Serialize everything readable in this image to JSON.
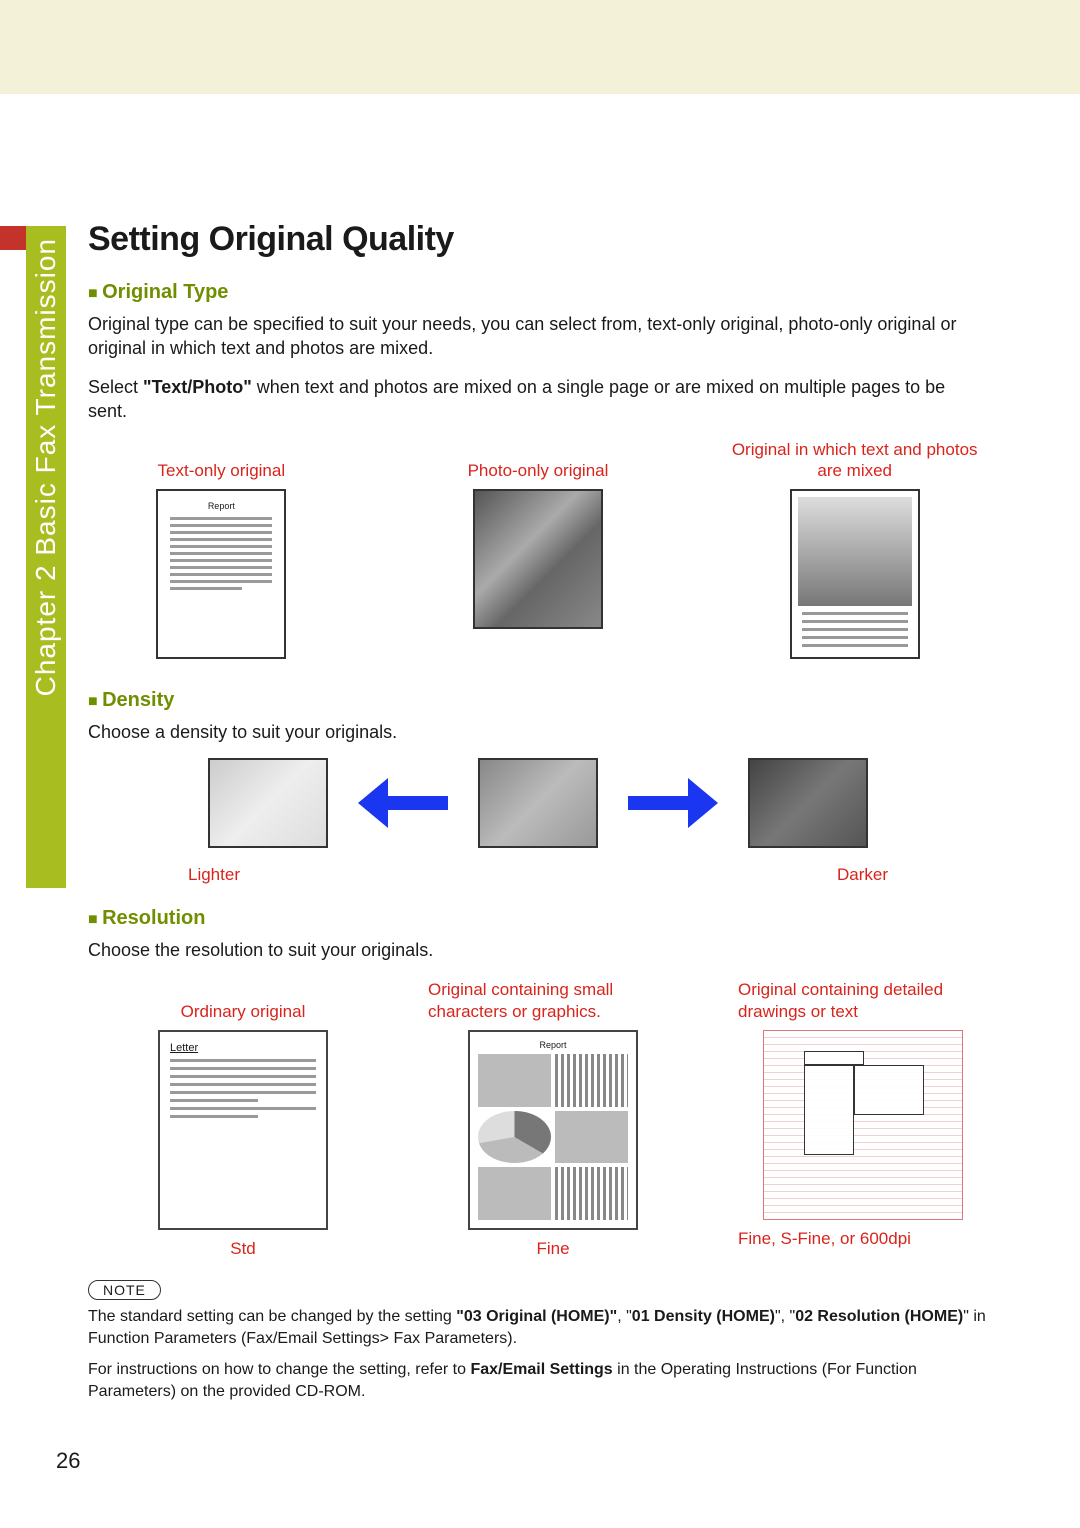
{
  "sidebar": {
    "label": "Chapter 2   Basic Fax Transmission"
  },
  "title": "Setting Original Quality",
  "sections": {
    "type": {
      "heading": "Original Type",
      "p1": "Original type can be specified to suit your needs, you can select from, text-only original, photo-only original or original in which text and photos are mixed.",
      "p2_pre": "Select ",
      "p2_bold": "\"Text/Photo\"",
      "p2_post": " when text and photos are mixed on a single page or are mixed on multiple pages to be sent.",
      "cap1": "Text-only original",
      "cap2": "Photo-only original",
      "cap3": "Original in which text and photos are mixed",
      "thumb_title": "Report"
    },
    "density": {
      "heading": "Density",
      "p1": "Choose a density to suit your originals.",
      "lighter": "Lighter",
      "darker": "Darker"
    },
    "resolution": {
      "heading": "Resolution",
      "p1": "Choose the resolution to suit your originals.",
      "cap1": "Ordinary original",
      "cap2": "Original containing small characters or graphics.",
      "cap3": "Original containing detailed drawings or text",
      "lab1": "Std",
      "lab2": "Fine",
      "lab3": "Fine, S-Fine, or 600dpi",
      "letter": "Letter",
      "report": "Report"
    }
  },
  "note": {
    "badge": "NOTE",
    "l1_pre": "The standard setting can be changed by the setting ",
    "l1_b1": "\"03 Original (HOME)\"",
    "l1_mid1": ", \"",
    "l1_b2": "01 Density (HOME)",
    "l1_mid2": "\", \"",
    "l1_b3": "02 Resolution (HOME)",
    "l1_post": "\" in Function Parameters (Fax/Email Settings> Fax Parameters).",
    "l2_pre": "For instructions on how to change the setting, refer to ",
    "l2_b": "Fax/Email Settings",
    "l2_post": " in the Operating Instructions (For Function Parameters) on the provided CD-ROM."
  },
  "page_number": "26"
}
